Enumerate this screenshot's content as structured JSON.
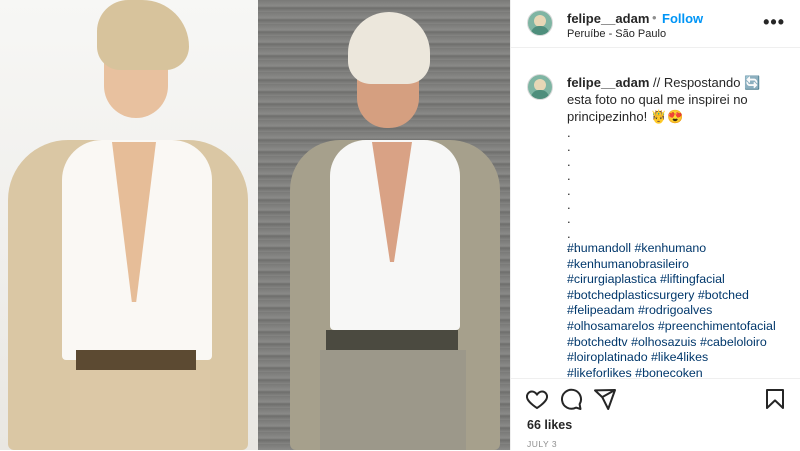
{
  "post": {
    "username": "felipe__adam",
    "separator": "•",
    "follow_label": "Follow",
    "location": "Peruíbe - São Paulo",
    "more_label": "•••",
    "caption": {
      "username": "felipe__adam",
      "text_1": " // Respostando ",
      "emoji_1": "🔄",
      "text_2": " esta foto no qual me inspirei no principezinho! ",
      "emoji_2": "🤴😍"
    },
    "dots": ".\n.\n.\n.\n.\n.\n.\n.\n. .",
    "hashtags": "#humandoll #kenhumano\n#kenhumanobrasileiro\n#cirurgiaplastica #liftingfacial\n#botchedplasticsurgery #botched\n#felipeadam #rodrigoalves\n#olhosamarelos #preenchimentofacial\n#botchedtv #olhosazuis #cabeloloiro\n#loiroplatinado #like4likes\n#likeforlikes #bonecoken",
    "likes": "66 likes",
    "date": "JULY 3"
  },
  "colors": {
    "accent": "#0095f6",
    "hashtag": "#00376b",
    "text": "#262626",
    "muted": "#8e8e8e"
  },
  "icons": [
    "heart-icon",
    "comment-icon",
    "share-icon",
    "bookmark-icon",
    "more-icon"
  ]
}
